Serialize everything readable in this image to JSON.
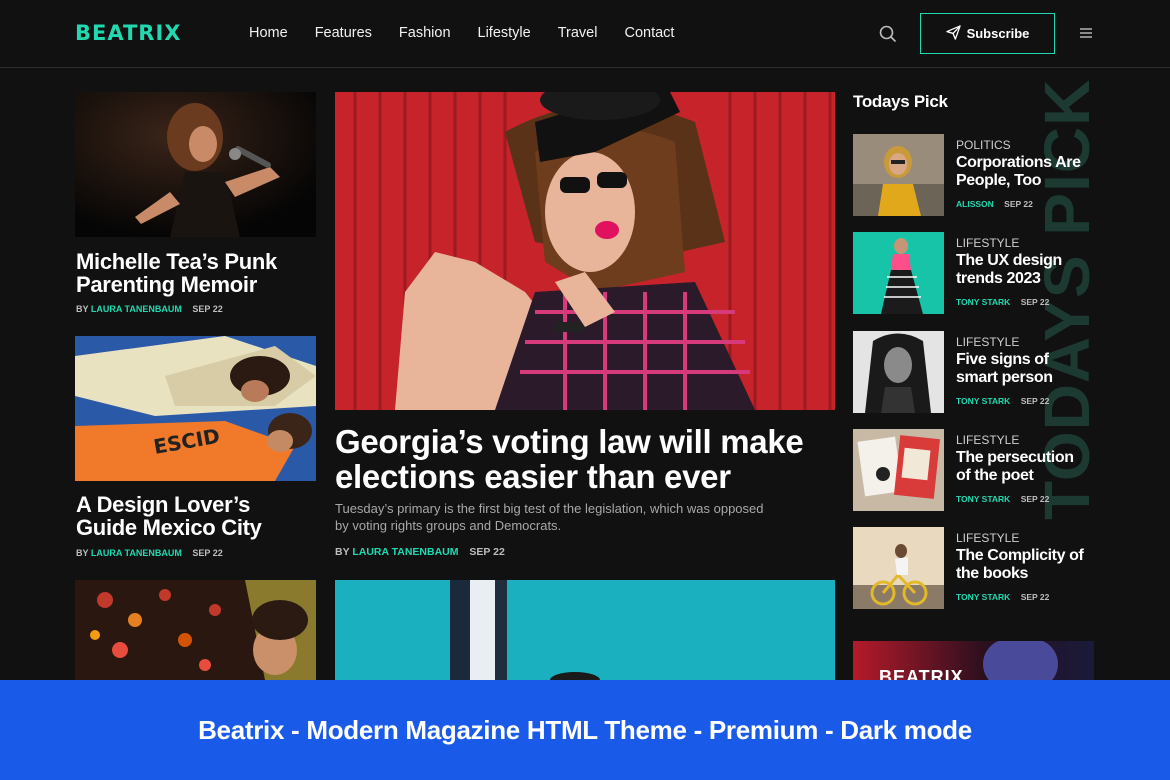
{
  "header": {
    "logo": "BEATRIX",
    "nav": [
      "Home",
      "Features",
      "Fashion",
      "Lifestyle",
      "Travel",
      "Contact"
    ],
    "subscribe_label": "Subscribe",
    "icons": [
      "search-icon",
      "paper-plane-icon",
      "hamburger-menu-icon"
    ]
  },
  "left_column": [
    {
      "title": "Michelle Tea’s Punk Parenting Memoir",
      "by": "BY",
      "author": "LAURA TANENBAUM",
      "date": "SEP 22"
    },
    {
      "title": "A Design Lover’s Guide Mexico City",
      "by": "BY",
      "author": "LAURA TANENBAUM",
      "date": "SEP 22"
    }
  ],
  "featured": {
    "title": "Georgia’s voting law will make elections easier than ever",
    "excerpt": "Tuesday’s primary is the first big test of the legislation, which was opposed by voting rights groups and Democrats.",
    "by": "BY",
    "author": "LAURA TANENBAUM",
    "date": "SEP 22"
  },
  "sidebar": {
    "heading": "Todays Pick",
    "vertical_label": "TODAYS PICK",
    "items": [
      {
        "category": "POLITICS",
        "title": "Corporations Are People, Too",
        "author": "ALISSON",
        "date": "SEP 22"
      },
      {
        "category": "LIFESTYLE",
        "title": "The UX design trends 2023",
        "author": "TONY STARK",
        "date": "SEP 22"
      },
      {
        "category": "LIFESTYLE",
        "title": "Five signs of smart person",
        "author": "TONY STARK",
        "date": "SEP 22"
      },
      {
        "category": "LIFESTYLE",
        "title": "The persecution of the poet",
        "author": "TONY STARK",
        "date": "SEP 22"
      },
      {
        "category": "LIFESTYLE",
        "title": "The Complicity of the books",
        "author": "TONY STARK",
        "date": "SEP 22"
      }
    ],
    "ad_text": "BEATRIX"
  },
  "banner": {
    "text": "Beatrix - Modern Magazine HTML Theme - Premium - Dark mode"
  },
  "colors": {
    "accent": "#21d9b0",
    "background": "#111111",
    "banner": "#1a5ae8"
  }
}
